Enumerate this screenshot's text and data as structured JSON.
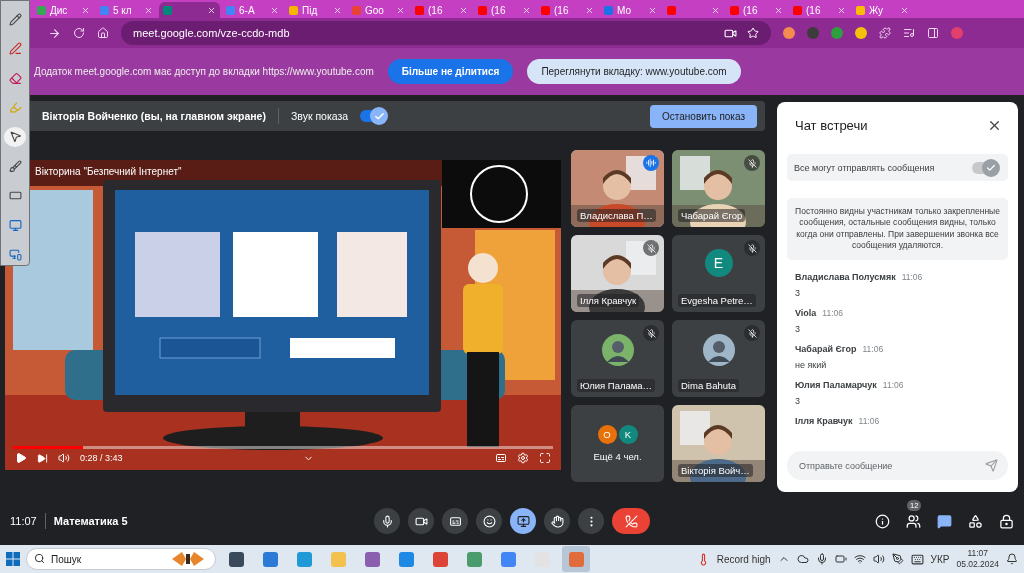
{
  "browser": {
    "tabs": [
      {
        "label": "Дис",
        "kind": "drive",
        "selected": false
      },
      {
        "label": "5 кл",
        "kind": "doc",
        "selected": false
      },
      {
        "kind": "meet",
        "selected": true
      },
      {
        "label": "6-А",
        "kind": "doc",
        "selected": false
      },
      {
        "label": "Під",
        "kind": "classroom",
        "selected": false
      },
      {
        "label": "Goo",
        "kind": "google",
        "selected": false
      },
      {
        "label": "(16",
        "kind": "youtube",
        "selected": false
      },
      {
        "label": "(16",
        "kind": "youtube",
        "selected": false
      },
      {
        "label": "(16",
        "kind": "youtube",
        "selected": false
      },
      {
        "label": "Мо",
        "kind": "board",
        "selected": false
      },
      {
        "kind": "youtube",
        "selected": false
      },
      {
        "label": "(16",
        "kind": "youtube",
        "selected": false
      },
      {
        "label": "(16",
        "kind": "youtube",
        "selected": false
      },
      {
        "label": "Жу",
        "kind": "star",
        "selected": false
      }
    ],
    "url": "meet.google.com/vze-ccdo-mdb"
  },
  "share_banner": {
    "message": "Додаток meet.google.com має доступ до вкладки https://www.youtube.com",
    "buttons": [
      {
        "label": "Більше не ділитися",
        "kind": "primary"
      },
      {
        "label": "Переглянути вкладку: www.youtube.com",
        "kind": "secondary"
      }
    ]
  },
  "presentation_bar": {
    "presenter": "Вікторія Войченко (вы, на главном экране)",
    "audio_label": "Звук показа",
    "audio_on": true,
    "stop_button": "Остановить показ"
  },
  "video": {
    "title": "Вікторина \"Безпечний Інтернет\"",
    "time": "0:28 / 3:43",
    "level": 0.13
  },
  "tiles": [
    {
      "name": "Владислава П…",
      "kind": "camera",
      "speaking": true,
      "muted": false
    },
    {
      "name": "Чабарай Єгор",
      "kind": "camera",
      "speaking": false,
      "muted": true
    },
    {
      "name": "Ілля Кравчук",
      "kind": "camera",
      "speaking": false,
      "muted": true
    },
    {
      "name": "Evgesha Petre…",
      "kind": "letter",
      "letter": "E",
      "color": "#12897e",
      "speaking": false,
      "muted": true
    },
    {
      "name": "Юлия Палама…",
      "kind": "avatar",
      "speaking": false,
      "muted": true
    },
    {
      "name": "Dima Bahuta",
      "kind": "avatar",
      "speaking": false,
      "muted": true
    },
    {
      "name": "Ещё 4 чел.",
      "kind": "more",
      "letters": [
        {
          "letter": "O",
          "color": "#e8710a"
        },
        {
          "letter": "K",
          "color": "#12897e"
        }
      ],
      "speaking": false,
      "muted": false
    },
    {
      "name": "Вікторія Войч…",
      "kind": "camera",
      "speaking": false,
      "muted": false
    }
  ],
  "chat": {
    "title": "Чат встречи",
    "permission": {
      "label": "Все могут отправлять сообщения",
      "on": true
    },
    "notice": "Постоянно видны участникам только закрепленные сообщения, остальные сообщения видны, только когда они отправлены. При завершении звонка все сообщения удаляются.",
    "messages": [
      {
        "author": "Владислава Полусмяк",
        "time": "11:06",
        "text": "3"
      },
      {
        "author": "Viola",
        "time": "11:06",
        "text": "3"
      },
      {
        "author": "Чабарай Єгор",
        "time": "11:06",
        "text": "не який"
      },
      {
        "author": "Юлия Паламарчук",
        "time": "11:06",
        "text": "3"
      },
      {
        "author": "Ілля Кравчук",
        "time": "11:06"
      }
    ],
    "placeholder": "Отправьте сообщение"
  },
  "bottom_bar": {
    "time": "11:07",
    "meeting": "Математика 5",
    "controls": [
      {
        "kind": "mic",
        "active": false
      },
      {
        "kind": "camera",
        "active": false
      },
      {
        "kind": "captions",
        "active": false
      },
      {
        "kind": "emoji",
        "active": false
      },
      {
        "kind": "present",
        "active": true
      },
      {
        "kind": "hand",
        "active": false
      },
      {
        "kind": "more",
        "active": false
      },
      {
        "kind": "leave",
        "active": false
      }
    ],
    "side_buttons": [
      {
        "kind": "info",
        "active": false
      },
      {
        "kind": "people",
        "badge": "12",
        "active": false
      },
      {
        "kind": "chat",
        "active": true
      },
      {
        "kind": "activities",
        "active": false
      },
      {
        "kind": "host",
        "active": false
      }
    ]
  },
  "taskbar": {
    "search_placeholder": "Пошук",
    "apps": [
      {
        "kind": "taskview",
        "selected": false
      },
      {
        "kind": "store",
        "selected": false
      },
      {
        "kind": "edge",
        "selected": false
      },
      {
        "kind": "explorer",
        "selected": false
      },
      {
        "kind": "app",
        "selected": false
      },
      {
        "kind": "mail",
        "selected": false
      },
      {
        "kind": "chrome",
        "selected": false
      },
      {
        "kind": "photos",
        "selected": false
      },
      {
        "kind": "docs",
        "selected": false
      },
      {
        "kind": "whiteboard",
        "selected": false
      },
      {
        "kind": "presenter",
        "selected": true
      }
    ],
    "weather": "Record high",
    "language": "УКР",
    "time": "11:07",
    "date": "05.02.2024"
  }
}
